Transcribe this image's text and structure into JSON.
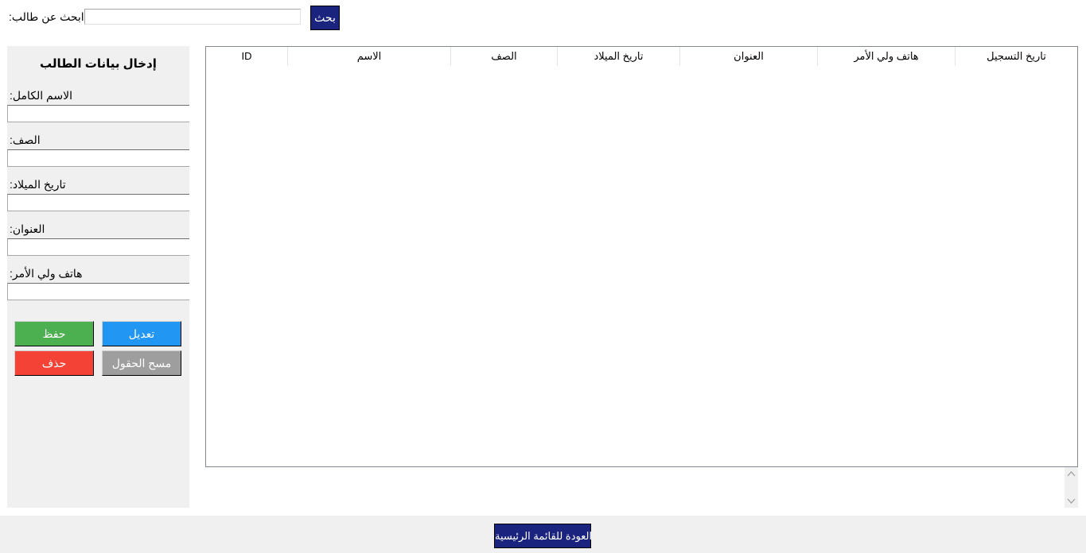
{
  "search": {
    "label": ":ابحث عن طالب",
    "value": "",
    "button_label": "بحث"
  },
  "form": {
    "title": "إدخال بيانات الطالب",
    "fields": [
      {
        "label": ":الاسم الكامل",
        "value": ""
      },
      {
        "label": ":الصف",
        "value": ""
      },
      {
        "label": ":تاريخ الميلاد",
        "value": ""
      },
      {
        "label": ":العنوان",
        "value": ""
      },
      {
        "label": ":هاتف ولي الأمر",
        "value": ""
      }
    ],
    "buttons": {
      "save": "حفظ",
      "edit": "تعديل",
      "delete": "حذف",
      "clear": "مسح الحقول"
    }
  },
  "table": {
    "columns": [
      "ID",
      "الاسم",
      "الصف",
      "تاريخ الميلاد",
      "العنوان",
      "هاتف ولي الأمر",
      "تاريخ التسجيل"
    ],
    "rows": []
  },
  "scrollbar": {
    "up_icon": "chevron-up-icon",
    "down_icon": "chevron-down-icon"
  },
  "footer": {
    "back_button_label": "العودة للقائمة الرئيسية"
  }
}
